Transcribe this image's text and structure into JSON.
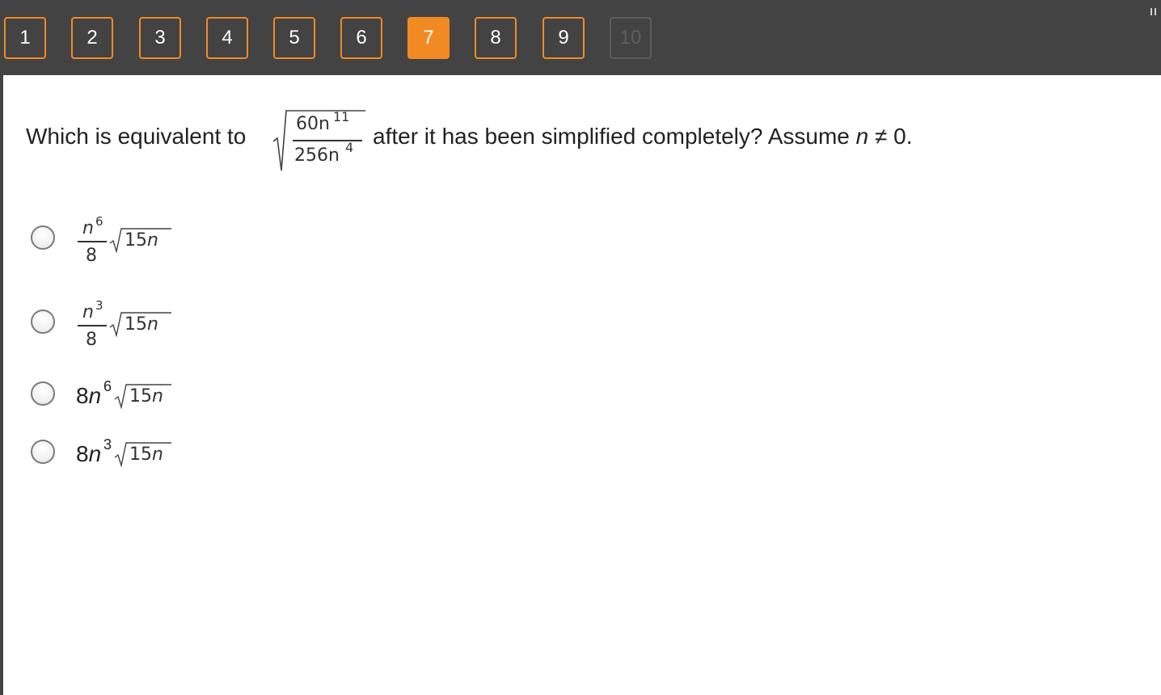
{
  "nav": {
    "questions": [
      {
        "label": "1",
        "state": "default"
      },
      {
        "label": "2",
        "state": "default"
      },
      {
        "label": "3",
        "state": "default"
      },
      {
        "label": "4",
        "state": "default"
      },
      {
        "label": "5",
        "state": "default"
      },
      {
        "label": "6",
        "state": "default"
      },
      {
        "label": "7",
        "state": "active"
      },
      {
        "label": "8",
        "state": "default"
      },
      {
        "label": "9",
        "state": "default"
      },
      {
        "label": "10",
        "state": "disabled"
      }
    ],
    "accent_color": "#f28a24",
    "bar_color": "#434343",
    "pause_icon": "pause-icon"
  },
  "question": {
    "prefix": "Which is equivalent to",
    "expression": {
      "numerator": "60n",
      "numerator_exp": "11",
      "denominator": "256n",
      "denominator_exp": "4"
    },
    "suffix": "after it has been simplified completely? Assume",
    "assumption_var": "n",
    "assumption_rest": " ≠ 0."
  },
  "options": [
    {
      "coefficient_num": "n",
      "exp": "6",
      "coefficient_den": "8",
      "radicand": "15",
      "radicand_var": "n",
      "form": "fraction"
    },
    {
      "coefficient_num": "n",
      "exp": "3",
      "coefficient_den": "8",
      "radicand": "15",
      "radicand_var": "n",
      "form": "fraction"
    },
    {
      "coefficient": "8",
      "var": "n",
      "exp": "6",
      "radicand": "15",
      "radicand_var": "n",
      "form": "inline"
    },
    {
      "coefficient": "8",
      "var": "n",
      "exp": "3",
      "radicand": "15",
      "radicand_var": "n",
      "form": "inline"
    }
  ]
}
